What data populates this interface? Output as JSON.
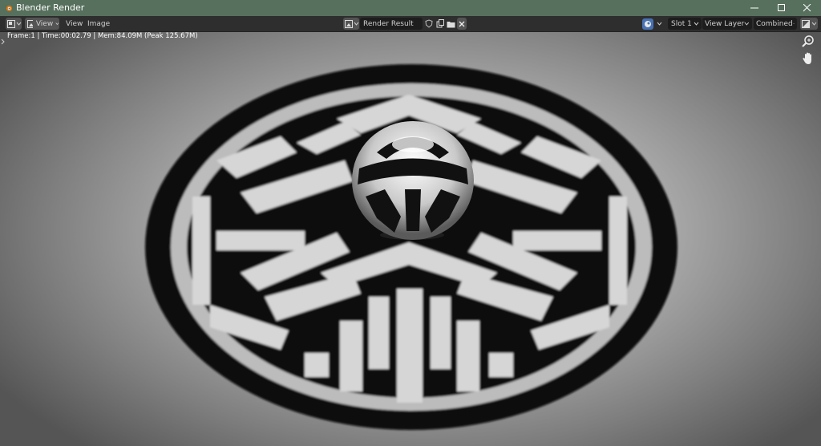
{
  "window": {
    "title": "Blender Render",
    "buttons": [
      "minimize-icon",
      "maximize-icon",
      "close-icon"
    ],
    "titlebar_color": "#57705d"
  },
  "toolbar": {
    "editor_type_icon": "image-editor-icon",
    "mode_icon": "view-mode-icon",
    "view_menu_label": "View",
    "menu_items": [
      "View",
      "Image"
    ],
    "image_name": "Render Result",
    "image_icons": [
      "shield-icon",
      "duplicate-icon",
      "folder-icon",
      "close-icon"
    ],
    "render_engine_icon": "render-icon",
    "slot": "Slot 1",
    "view_layer": "View Layer",
    "pass": "Combined",
    "display_icon": "display-channels-icon"
  },
  "viewport": {
    "render_info": "Frame:1 | Time:00:02.79 | Mem:84.09M (Peak 125.67M)",
    "tools": [
      "zoom-icon",
      "pan-hand-icon"
    ],
    "content": "render of a black disc with white maze-like six-armed emblem and a reflective chrome sphere"
  }
}
